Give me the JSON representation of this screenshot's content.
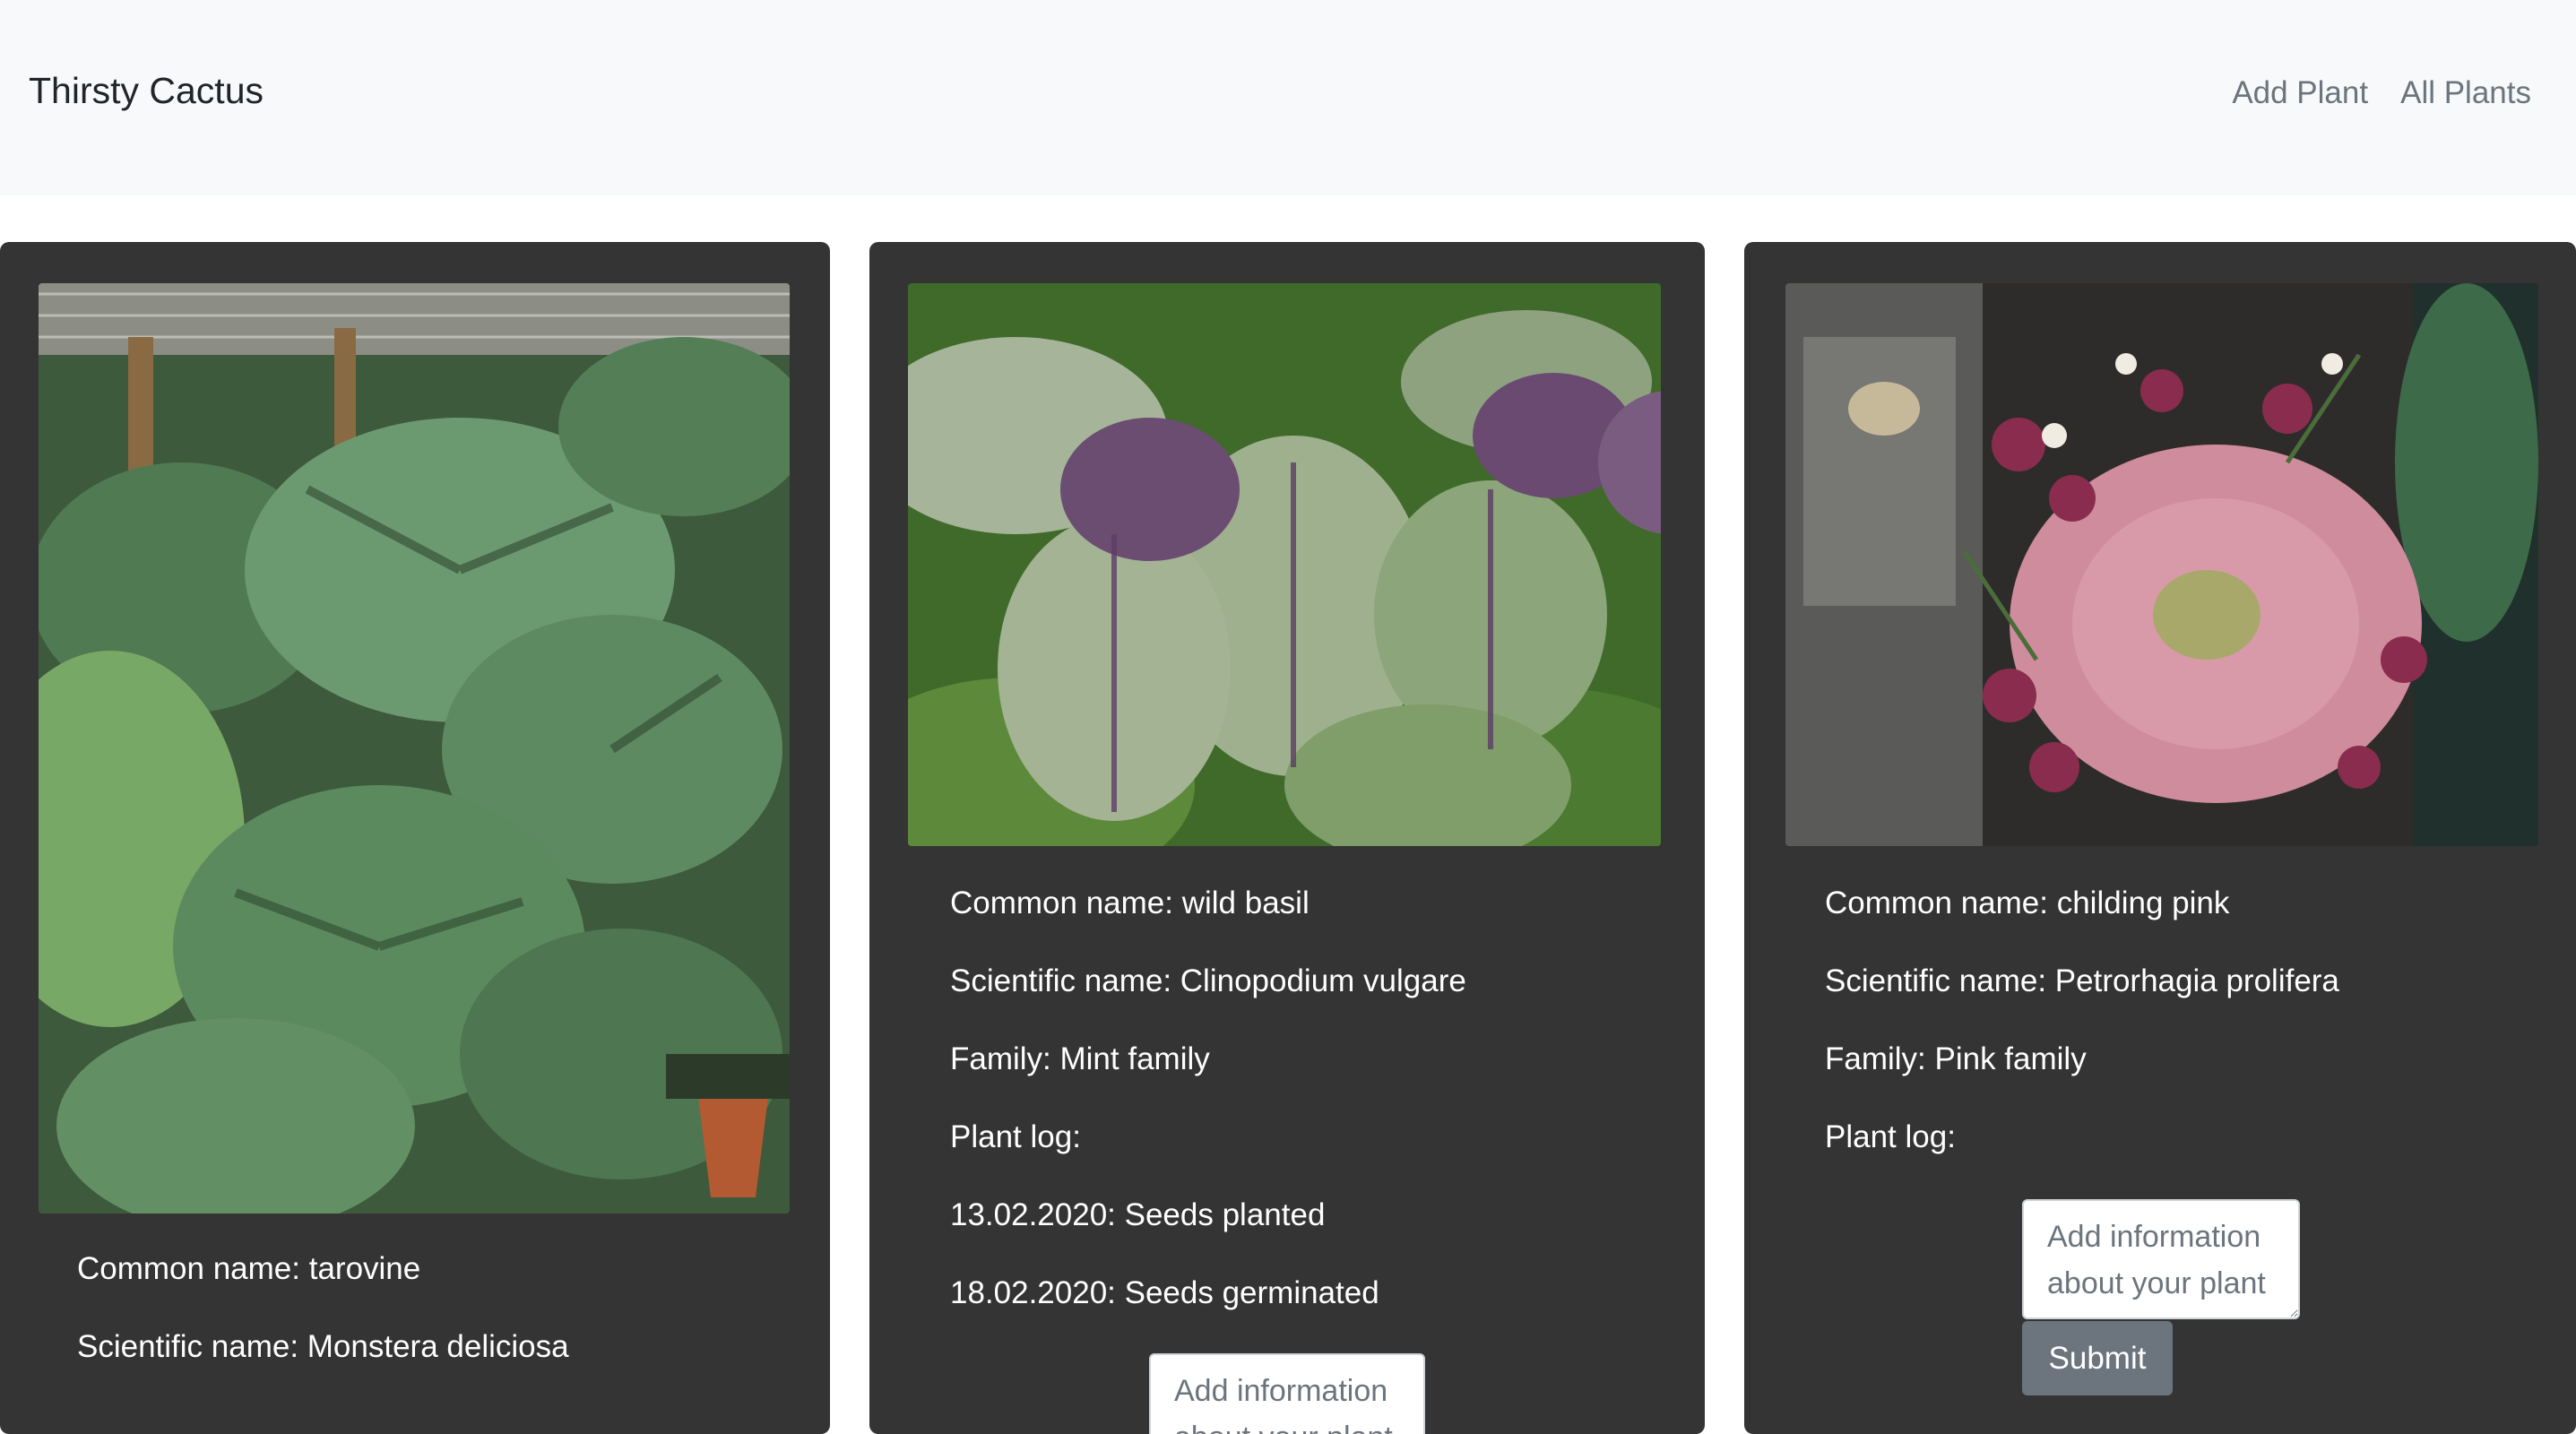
{
  "navbar": {
    "brand": "Thirsty Cactus",
    "links": [
      "Add Plant",
      "All Plants"
    ]
  },
  "labels": {
    "common": "Common name: ",
    "scientific": "Scientific name: ",
    "family": "Family: ",
    "log": "Plant log:"
  },
  "plants": [
    {
      "common_name": "tarovine",
      "scientific_name": "Monstera deliciosa",
      "image": "monstera-leaves-photo"
    },
    {
      "common_name": "wild basil",
      "scientific_name": "Clinopodium vulgare",
      "family": "Mint family",
      "image": "purple-basil-photo",
      "log": [
        "13.02.2020: Seeds planted",
        "18.02.2020: Seeds germinated"
      ],
      "input_placeholder": "Add information about your plant"
    },
    {
      "common_name": "childing pink",
      "scientific_name": "Petrorhagia prolifera",
      "family": "Pink family",
      "image": "pink-flower-bouquet-photo",
      "input_placeholder": "Add information about your plant",
      "submit_label": "Submit"
    }
  ],
  "colors": {
    "navbar_bg": "#f8f9fa",
    "card_bg": "#343434",
    "button": "#6c757d"
  }
}
